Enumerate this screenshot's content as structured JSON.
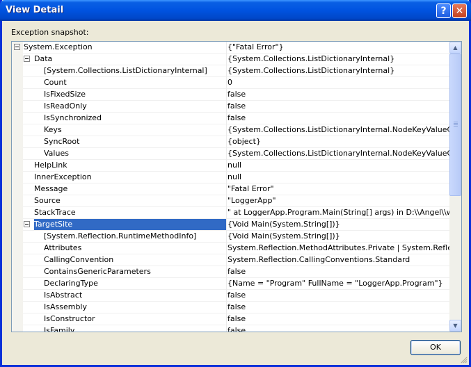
{
  "window": {
    "title": "View Detail"
  },
  "caption_buttons": {
    "help": "?",
    "close": "✕"
  },
  "section_label": "Exception snapshot:",
  "rows": [
    {
      "name": "System.Exception",
      "value": "{\"Fatal Error\"}",
      "indent": 0,
      "toggle": true
    },
    {
      "name": "Data",
      "value": "{System.Collections.ListDictionaryInternal}",
      "indent": 1,
      "toggle": true
    },
    {
      "name": "[System.Collections.ListDictionaryInternal]",
      "value": "{System.Collections.ListDictionaryInternal}",
      "indent": 2,
      "toggle": false
    },
    {
      "name": "Count",
      "value": "0",
      "indent": 2,
      "toggle": false
    },
    {
      "name": "IsFixedSize",
      "value": "false",
      "indent": 2,
      "toggle": false
    },
    {
      "name": "IsReadOnly",
      "value": "false",
      "indent": 2,
      "toggle": false
    },
    {
      "name": "IsSynchronized",
      "value": "false",
      "indent": 2,
      "toggle": false
    },
    {
      "name": "Keys",
      "value": "{System.Collections.ListDictionaryInternal.NodeKeyValueCollection}",
      "indent": 2,
      "toggle": false
    },
    {
      "name": "SyncRoot",
      "value": "{object}",
      "indent": 2,
      "toggle": false
    },
    {
      "name": "Values",
      "value": "{System.Collections.ListDictionaryInternal.NodeKeyValueCollection}",
      "indent": 2,
      "toggle": false
    },
    {
      "name": "HelpLink",
      "value": "null",
      "indent": 1,
      "toggle": false
    },
    {
      "name": "InnerException",
      "value": "null",
      "indent": 1,
      "toggle": false
    },
    {
      "name": "Message",
      "value": "\"Fatal Error\"",
      "indent": 1,
      "toggle": false
    },
    {
      "name": "Source",
      "value": "\"LoggerApp\"",
      "indent": 1,
      "toggle": false
    },
    {
      "name": "StackTrace",
      "value": "\"   at LoggerApp.Program.Main(String[] args) in D:\\\\Angel\\\\wcf\\\\Lo",
      "indent": 1,
      "toggle": false
    },
    {
      "name": "TargetSite",
      "value": "{Void Main(System.String[])}",
      "indent": 1,
      "toggle": true,
      "selected": true
    },
    {
      "name": "[System.Reflection.RuntimeMethodInfo]",
      "value": "{Void Main(System.String[])}",
      "indent": 2,
      "toggle": false
    },
    {
      "name": "Attributes",
      "value": "System.Reflection.MethodAttributes.Private | System.Reflection.M",
      "indent": 2,
      "toggle": false
    },
    {
      "name": "CallingConvention",
      "value": "System.Reflection.CallingConventions.Standard",
      "indent": 2,
      "toggle": false
    },
    {
      "name": "ContainsGenericParameters",
      "value": "false",
      "indent": 2,
      "toggle": false
    },
    {
      "name": "DeclaringType",
      "value": "{Name = \"Program\" FullName = \"LoggerApp.Program\"}",
      "indent": 2,
      "toggle": false
    },
    {
      "name": "IsAbstract",
      "value": "false",
      "indent": 2,
      "toggle": false
    },
    {
      "name": "IsAssembly",
      "value": "false",
      "indent": 2,
      "toggle": false
    },
    {
      "name": "IsConstructor",
      "value": "false",
      "indent": 2,
      "toggle": false
    },
    {
      "name": "IsFamily",
      "value": "false",
      "indent": 2,
      "toggle": false
    }
  ],
  "scrollbar": {
    "up": "▲",
    "down": "▼",
    "position": 0.0
  },
  "ok_button": "OK",
  "colors": {
    "selection": "#316ac5",
    "titlebar": "#0053e0",
    "grid_border": "#7f9db9"
  }
}
